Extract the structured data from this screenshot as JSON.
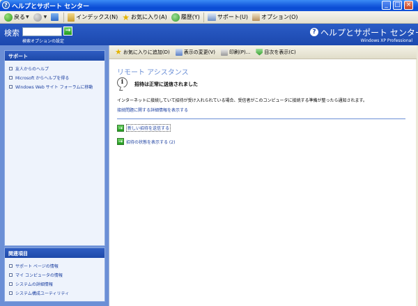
{
  "window": {
    "title": "ヘルプとサポート センター",
    "icon_text": "?"
  },
  "toolbar": {
    "back": "戻る",
    "index": "インデックス(N)",
    "favorites": "お気に入り(A)",
    "history": "履歴(Y)",
    "support": "サポート(U)",
    "options": "オプション(O)"
  },
  "header": {
    "search_label": "検索",
    "search_value": "",
    "search_options": "検索オプションの設定",
    "brand_title": "ヘルプとサポート センター",
    "brand_subtitle": "Windows XP Professional"
  },
  "sidebar": {
    "support_box": {
      "title": "サポート",
      "items": [
        "友人からのヘルプ",
        "Microsoft からヘルプを得る",
        "Windows Web サイト フォーラムに移動"
      ]
    },
    "related_box": {
      "title": "関連項目",
      "items": [
        "サポート ページの情報",
        "マイ コンピュータの情報",
        "システムの詳細情報",
        "システム構成ユーティリティ"
      ]
    }
  },
  "content_toolbar": {
    "add_favorite": "お気に入りに追加(D)",
    "change_view": "表示の変更(V)",
    "print": "印刷(P)...",
    "show_toc": "目次を表示(C)"
  },
  "main": {
    "title": "リモート アシスタンス",
    "status": "招待は正常に送信されました",
    "description": "インターネットに接続していて招待が受け入れられている場合、受信者がこのコンピュータに接続する準備が整ったら通知されます。",
    "detail_link": "接続問題に関する詳細情報を表示する",
    "actions": [
      "新しい招待を送信する",
      "招待の状態を表示する (2)"
    ]
  }
}
